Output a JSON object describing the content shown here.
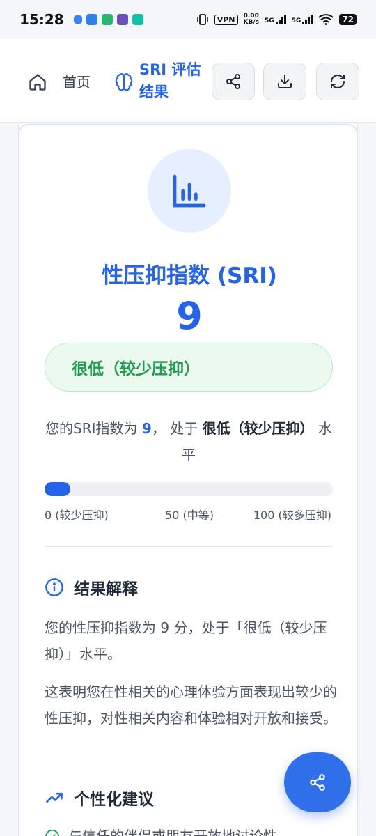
{
  "status_bar": {
    "time": "15:28",
    "vpn": "VPN",
    "net_speed_value": "0.00",
    "net_speed_unit": "KB/s",
    "signal_1": "5G",
    "signal_2": "5G",
    "battery": "72"
  },
  "header": {
    "home_label": "首页",
    "current_page": "SRI 评估结果"
  },
  "result": {
    "title": "性压抑指数 (SRI)",
    "score": "9",
    "level_label": "很低（较少压抑）",
    "summary_prefix": "您的SRI指数为 ",
    "summary_score": "9",
    "summary_middle": "， 处于 ",
    "summary_level": "很低（较少压抑）",
    "summary_suffix": " 水平",
    "progress_fraction": 0.09,
    "scale_min": "0 (较少压抑)",
    "scale_mid": "50 (中等)",
    "scale_max": "100 (较多压抑)"
  },
  "interpretation": {
    "heading": "结果解释",
    "para1": "您的性压抑指数为 9 分，处于「很低（较少压抑）」水平。",
    "para2": "这表明您在性相关的心理体验方面表现出较少的性压抑，对性相关内容和体验相对开放和接受。"
  },
  "advice": {
    "heading": "个性化建议",
    "item1": "与信任的伴侣或朋友开放地讨论性"
  },
  "colors": {
    "accent": "#2563eb",
    "success": "#1f9d4d",
    "success_bg": "#ebf9ef"
  }
}
